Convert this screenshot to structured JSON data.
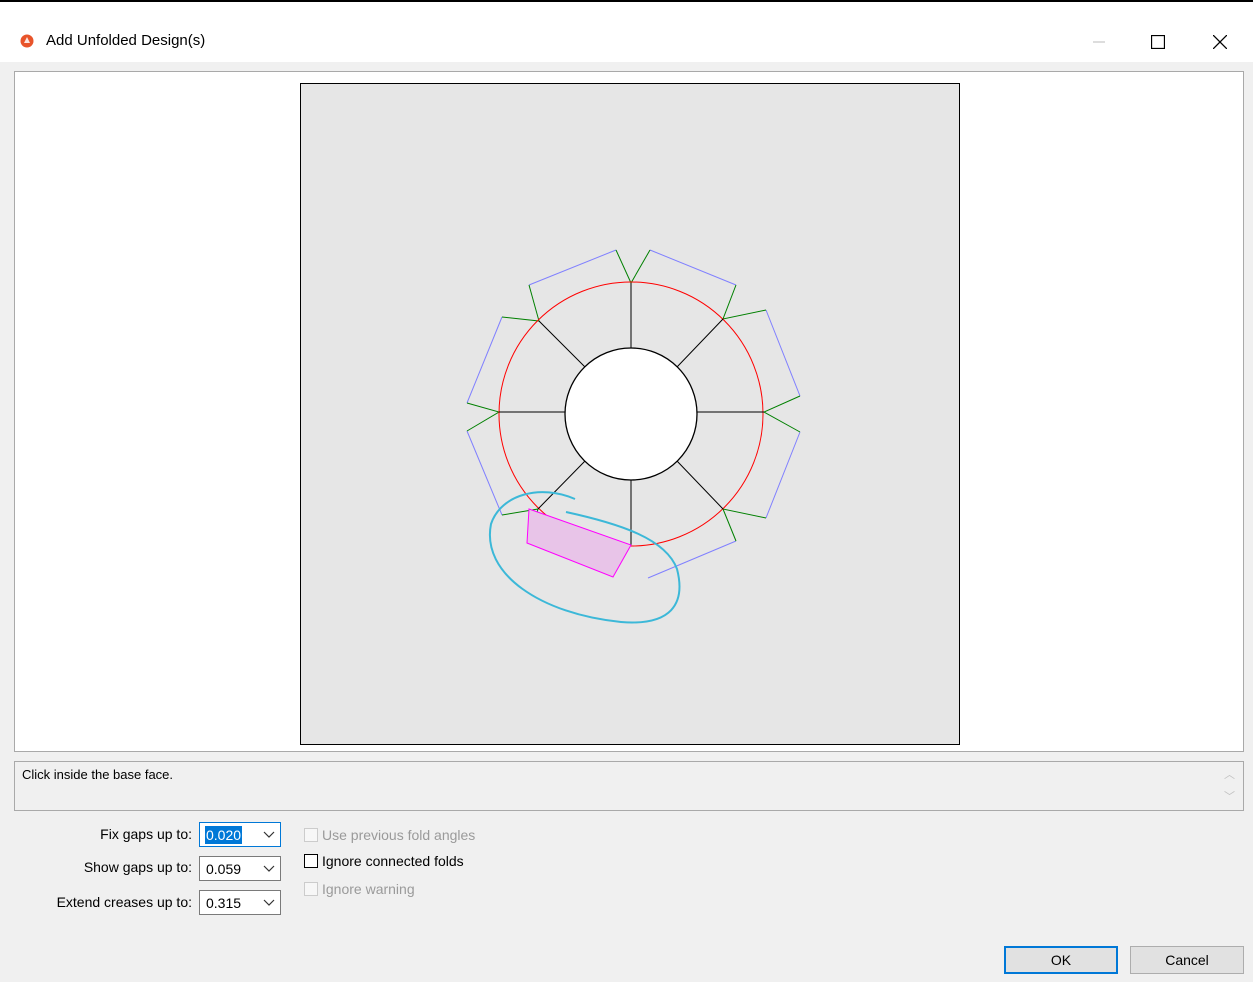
{
  "window": {
    "title": "Add Unfolded Design(s)",
    "app_icon": "origami-logo-icon",
    "controls": [
      "minimize",
      "maximize",
      "close"
    ]
  },
  "status": {
    "message": "Click inside the base face."
  },
  "options": {
    "fix_gaps": {
      "label": "Fix gaps up to:",
      "value": "0.020"
    },
    "show_gaps": {
      "label": "Show gaps up to:",
      "value": "0.059"
    },
    "extend_creases": {
      "label": "Extend creases up to:",
      "value": "0.315"
    }
  },
  "checkboxes": [
    {
      "label": "Use previous fold angles",
      "checked": false,
      "enabled": false
    },
    {
      "label": "Ignore connected folds",
      "checked": false,
      "enabled": true
    },
    {
      "label": "Ignore warning",
      "checked": false,
      "enabled": false
    }
  ],
  "buttons": {
    "ok": "OK",
    "cancel": "Cancel"
  },
  "design_colors": {
    "cut_lines": "#000000",
    "fold_circle": "#ff0000",
    "flap_outline": "#8080ff",
    "fold_lines": "#008000",
    "selected_flap": "#ff00ff",
    "annotation": "#3cb8d8"
  }
}
